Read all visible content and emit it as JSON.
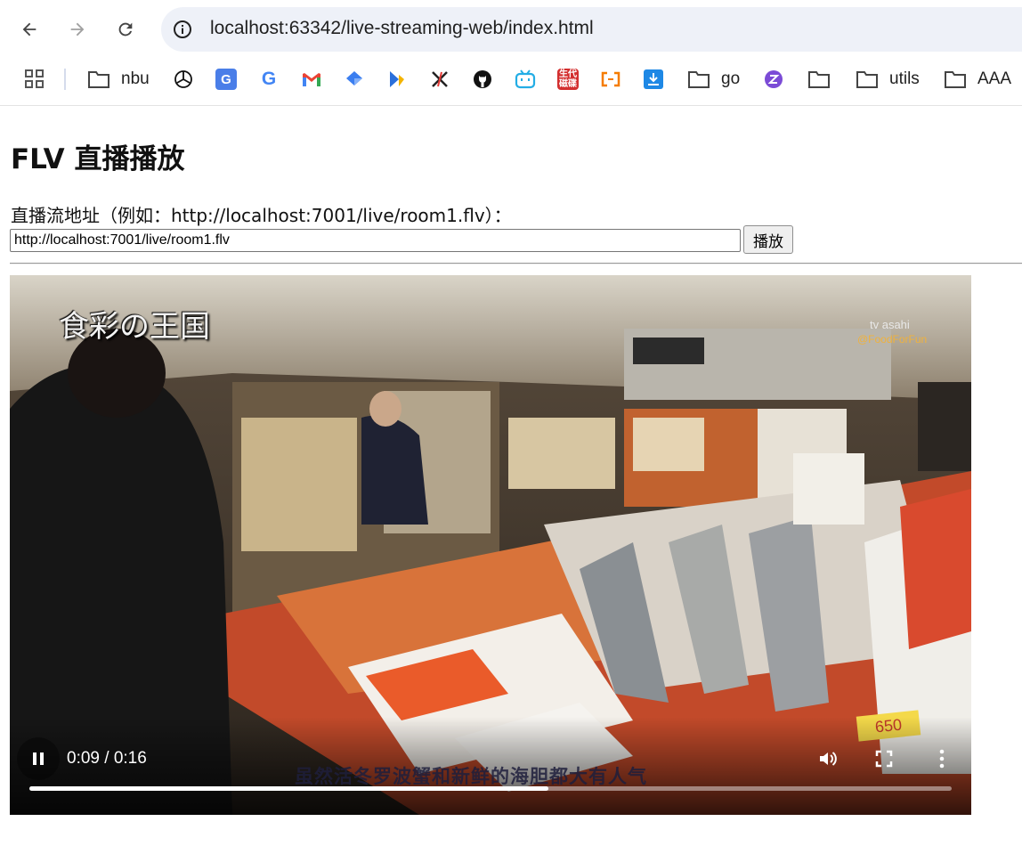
{
  "browser": {
    "url": "localhost:63342/live-streaming-web/index.html",
    "bookmarks": [
      {
        "label": "nbu",
        "icon": "folder-icon"
      },
      {
        "label": "",
        "icon": "openai-icon"
      },
      {
        "label": "",
        "icon": "google-translate-icon"
      },
      {
        "label": "",
        "icon": "google-icon"
      },
      {
        "label": "",
        "icon": "gmail-icon"
      },
      {
        "label": "",
        "icon": "diamond-icon"
      },
      {
        "label": "",
        "icon": "bird-icon"
      },
      {
        "label": "",
        "icon": "x-icon"
      },
      {
        "label": "",
        "icon": "github-icon"
      },
      {
        "label": "",
        "icon": "bilibili-icon"
      },
      {
        "label": "",
        "icon": "generation-icon"
      },
      {
        "label": "",
        "icon": "brackets-icon"
      },
      {
        "label": "",
        "icon": "download-icon"
      },
      {
        "label": "go",
        "icon": "folder-icon"
      },
      {
        "label": "",
        "icon": "zotero-icon"
      },
      {
        "label": "",
        "icon": "folder-icon"
      },
      {
        "label": "utils",
        "icon": "folder-icon"
      },
      {
        "label": "AAA",
        "icon": "folder-icon"
      }
    ],
    "generation_badge": "生代\n磁碟"
  },
  "page": {
    "title": "FLV 直播播放",
    "stream_label": "直播流地址（例如：http://localhost:7001/live/room1.flv）：",
    "stream_value": "http://localhost:7001/live/room1.flv",
    "play_label": "播放"
  },
  "video": {
    "time_display": "0:09 / 0:16",
    "progress": 0.5625,
    "overlay_logo": "食彩の王国",
    "channel_mark": "tv asahi",
    "channel_sub": "@FoodForFun",
    "price_tag": "650",
    "subtitle": "虽然活冬罗波蟹和新鲜的海胆都大有人气"
  }
}
